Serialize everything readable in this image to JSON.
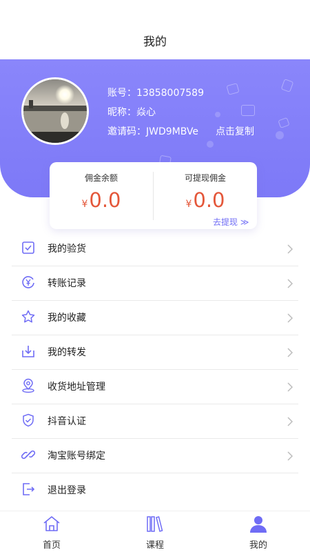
{
  "nav": {
    "title": "我的"
  },
  "profile": {
    "account_label": "账号：",
    "account_value": "13858007589",
    "nickname_label": "昵称：",
    "nickname_value": "焱心",
    "invite_label": "邀请码：",
    "invite_value": "JWD9MBVe",
    "copy_label": "点击复制"
  },
  "balance": {
    "currency": "¥",
    "left_label": "佣金余额",
    "left_value": "0.0",
    "right_label": "可提现佣金",
    "right_value": "0.0",
    "withdraw_label": "去提现 ≫"
  },
  "menu": [
    {
      "label": "我的验货",
      "icon": "inspect-box-icon"
    },
    {
      "label": "转账记录",
      "icon": "yen-refresh-icon"
    },
    {
      "label": "我的收藏",
      "icon": "star-icon"
    },
    {
      "label": "我的转发",
      "icon": "download-tray-icon"
    },
    {
      "label": "收货地址管理",
      "icon": "location-pin-icon"
    },
    {
      "label": "抖音认证",
      "icon": "shield-check-icon"
    },
    {
      "label": "淘宝账号绑定",
      "icon": "link-icon"
    },
    {
      "label": "退出登录",
      "icon": "logout-icon"
    }
  ],
  "tabs": [
    {
      "label": "首页",
      "icon": "home-icon",
      "active": false
    },
    {
      "label": "课程",
      "icon": "books-icon",
      "active": false
    },
    {
      "label": "我的",
      "icon": "user-icon",
      "active": true
    }
  ],
  "colors": {
    "accent": "#7d79f7",
    "money": "#e4573a",
    "active_tab": "#6f6cf5",
    "icon_stroke": "#6f6cf5"
  }
}
